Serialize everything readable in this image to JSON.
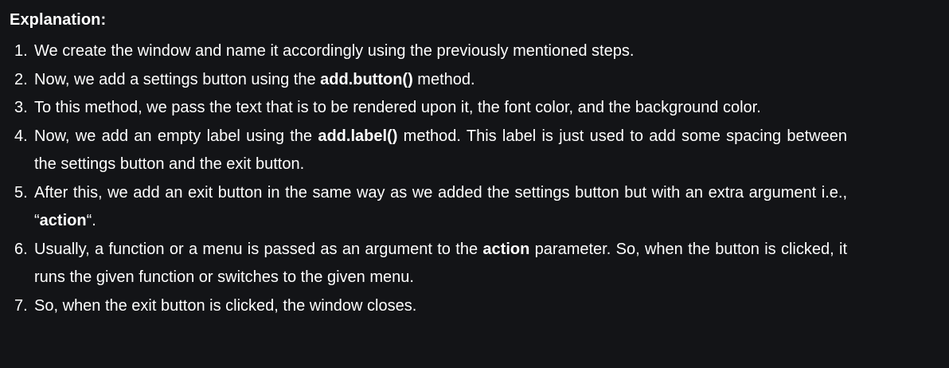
{
  "heading": "Explanation:",
  "steps": [
    {
      "num": "1.",
      "parts": [
        {
          "text": "We create the window and name it accordingly using the previously mentioned steps.",
          "bold": false
        }
      ]
    },
    {
      "num": "2.",
      "parts": [
        {
          "text": "Now, we add a settings button using the ",
          "bold": false
        },
        {
          "text": "add.button()",
          "bold": true
        },
        {
          "text": " method.",
          "bold": false
        }
      ]
    },
    {
      "num": "3.",
      "parts": [
        {
          "text": "To this method, we pass the text that is to be rendered upon it, the font color, and the background color.",
          "bold": false
        }
      ]
    },
    {
      "num": "4.",
      "parts": [
        {
          "text": "Now, we add an empty label using the ",
          "bold": false
        },
        {
          "text": "add.label()",
          "bold": true
        },
        {
          "text": " method. This label is just used to add some spacing between the settings button and the exit button.",
          "bold": false
        }
      ]
    },
    {
      "num": "5.",
      "parts": [
        {
          "text": "After this, we add an exit button in the same way as we added the settings button but with an extra argument i.e., “",
          "bold": false
        },
        {
          "text": "action",
          "bold": true
        },
        {
          "text": "“.",
          "bold": false
        }
      ]
    },
    {
      "num": "6.",
      "parts": [
        {
          "text": "Usually, a function or a menu is passed as an argument to the ",
          "bold": false
        },
        {
          "text": "action",
          "bold": true
        },
        {
          "text": " parameter. So, when the button is clicked, it runs the given function or switches to the given menu.",
          "bold": false
        }
      ]
    },
    {
      "num": "7.",
      "parts": [
        {
          "text": "So, when the exit button is clicked, the window closes.",
          "bold": false
        }
      ]
    }
  ]
}
